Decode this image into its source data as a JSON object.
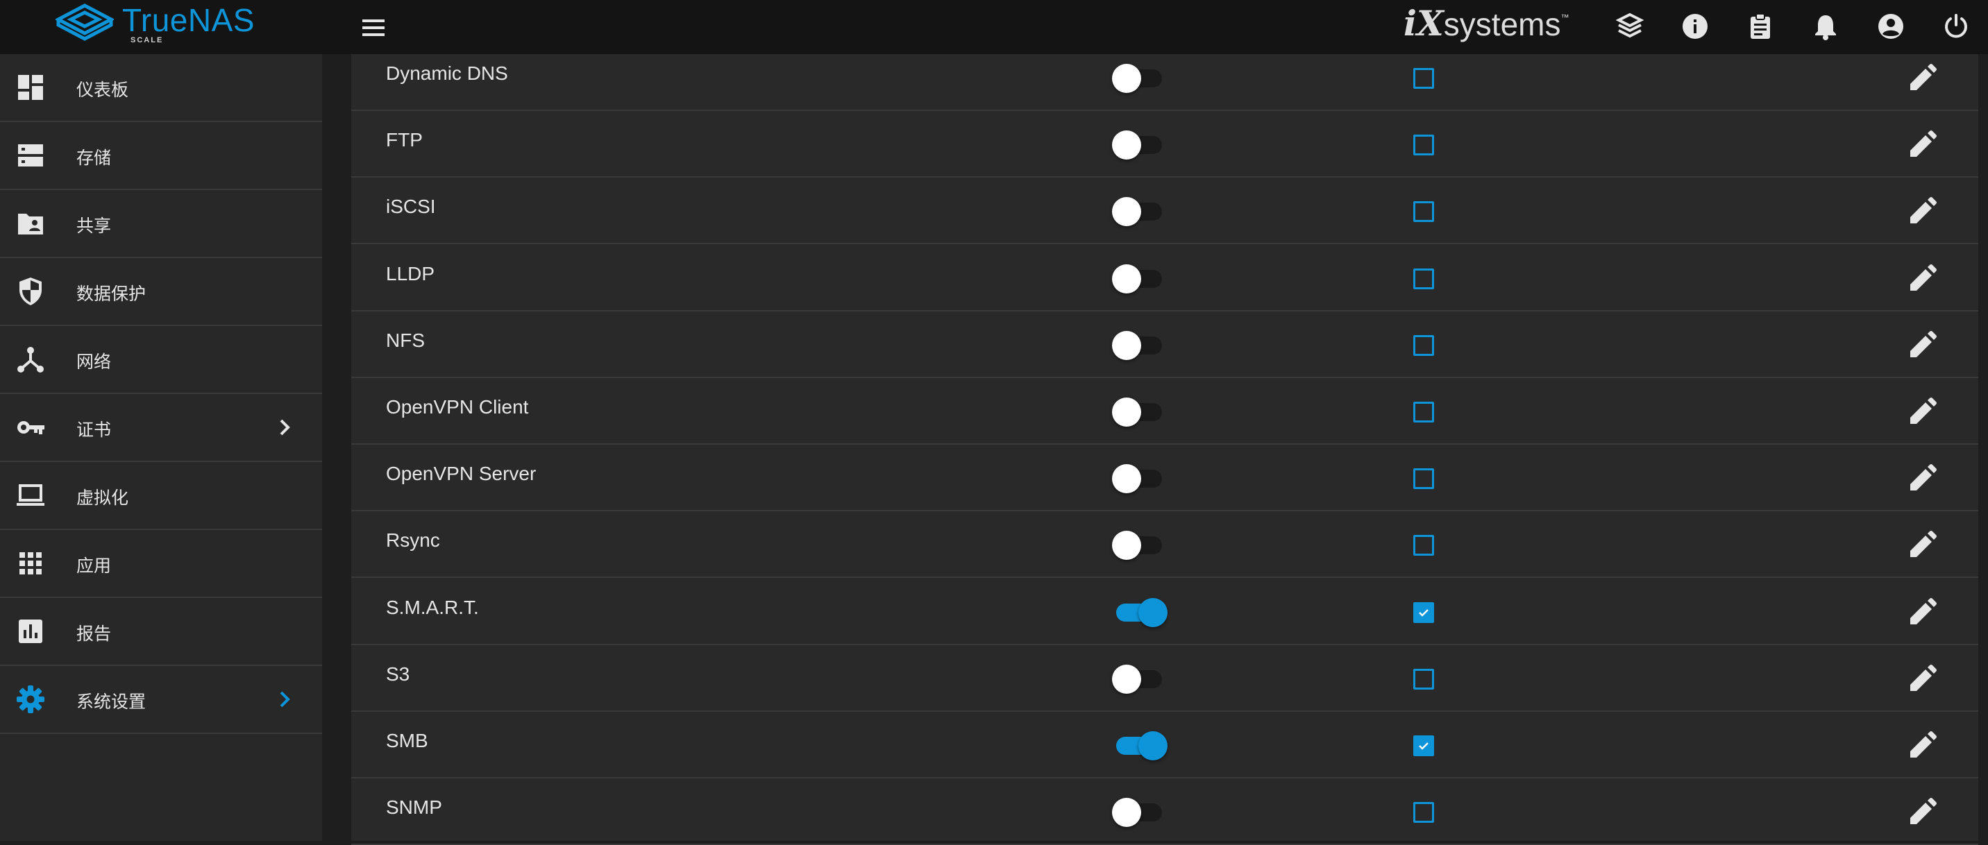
{
  "header": {
    "brand_name": "TrueNAS",
    "brand_edition": "SCALE",
    "vendor_logo_ix": "iX",
    "vendor_logo_text": "systems",
    "vendor_logo_tm": "™",
    "accent_color": "#0e95d9",
    "icons": [
      "menu-icon",
      "truecommand-icon",
      "info-icon",
      "tasks-clipboard-icon",
      "notifications-bell-icon",
      "account-circle-icon",
      "power-icon"
    ]
  },
  "sidebar": {
    "items": [
      {
        "label": "仪表板",
        "icon": "dashboard-icon"
      },
      {
        "label": "存储",
        "icon": "storage-icon"
      },
      {
        "label": "共享",
        "icon": "shared-folder-icon"
      },
      {
        "label": "数据保护",
        "icon": "security-shield-icon"
      },
      {
        "label": "网络",
        "icon": "network-icon"
      },
      {
        "label": "证书",
        "icon": "key-icon",
        "has_children": true
      },
      {
        "label": "虚拟化",
        "icon": "laptop-icon"
      },
      {
        "label": "应用",
        "icon": "apps-grid-icon"
      },
      {
        "label": "报告",
        "icon": "reporting-chart-icon"
      },
      {
        "label": "系统设置",
        "icon": "settings-gear-icon",
        "has_children": true,
        "active": true
      }
    ]
  },
  "services": [
    {
      "name": "Dynamic DNS",
      "running": false,
      "start_automatically": false
    },
    {
      "name": "FTP",
      "running": false,
      "start_automatically": false
    },
    {
      "name": "iSCSI",
      "running": false,
      "start_automatically": false
    },
    {
      "name": "LLDP",
      "running": false,
      "start_automatically": false
    },
    {
      "name": "NFS",
      "running": false,
      "start_automatically": false
    },
    {
      "name": "OpenVPN Client",
      "running": false,
      "start_automatically": false
    },
    {
      "name": "OpenVPN Server",
      "running": false,
      "start_automatically": false
    },
    {
      "name": "Rsync",
      "running": false,
      "start_automatically": false
    },
    {
      "name": "S.M.A.R.T.",
      "running": true,
      "start_automatically": true
    },
    {
      "name": "S3",
      "running": false,
      "start_automatically": false
    },
    {
      "name": "SMB",
      "running": true,
      "start_automatically": true
    },
    {
      "name": "SNMP",
      "running": false,
      "start_automatically": false
    }
  ]
}
